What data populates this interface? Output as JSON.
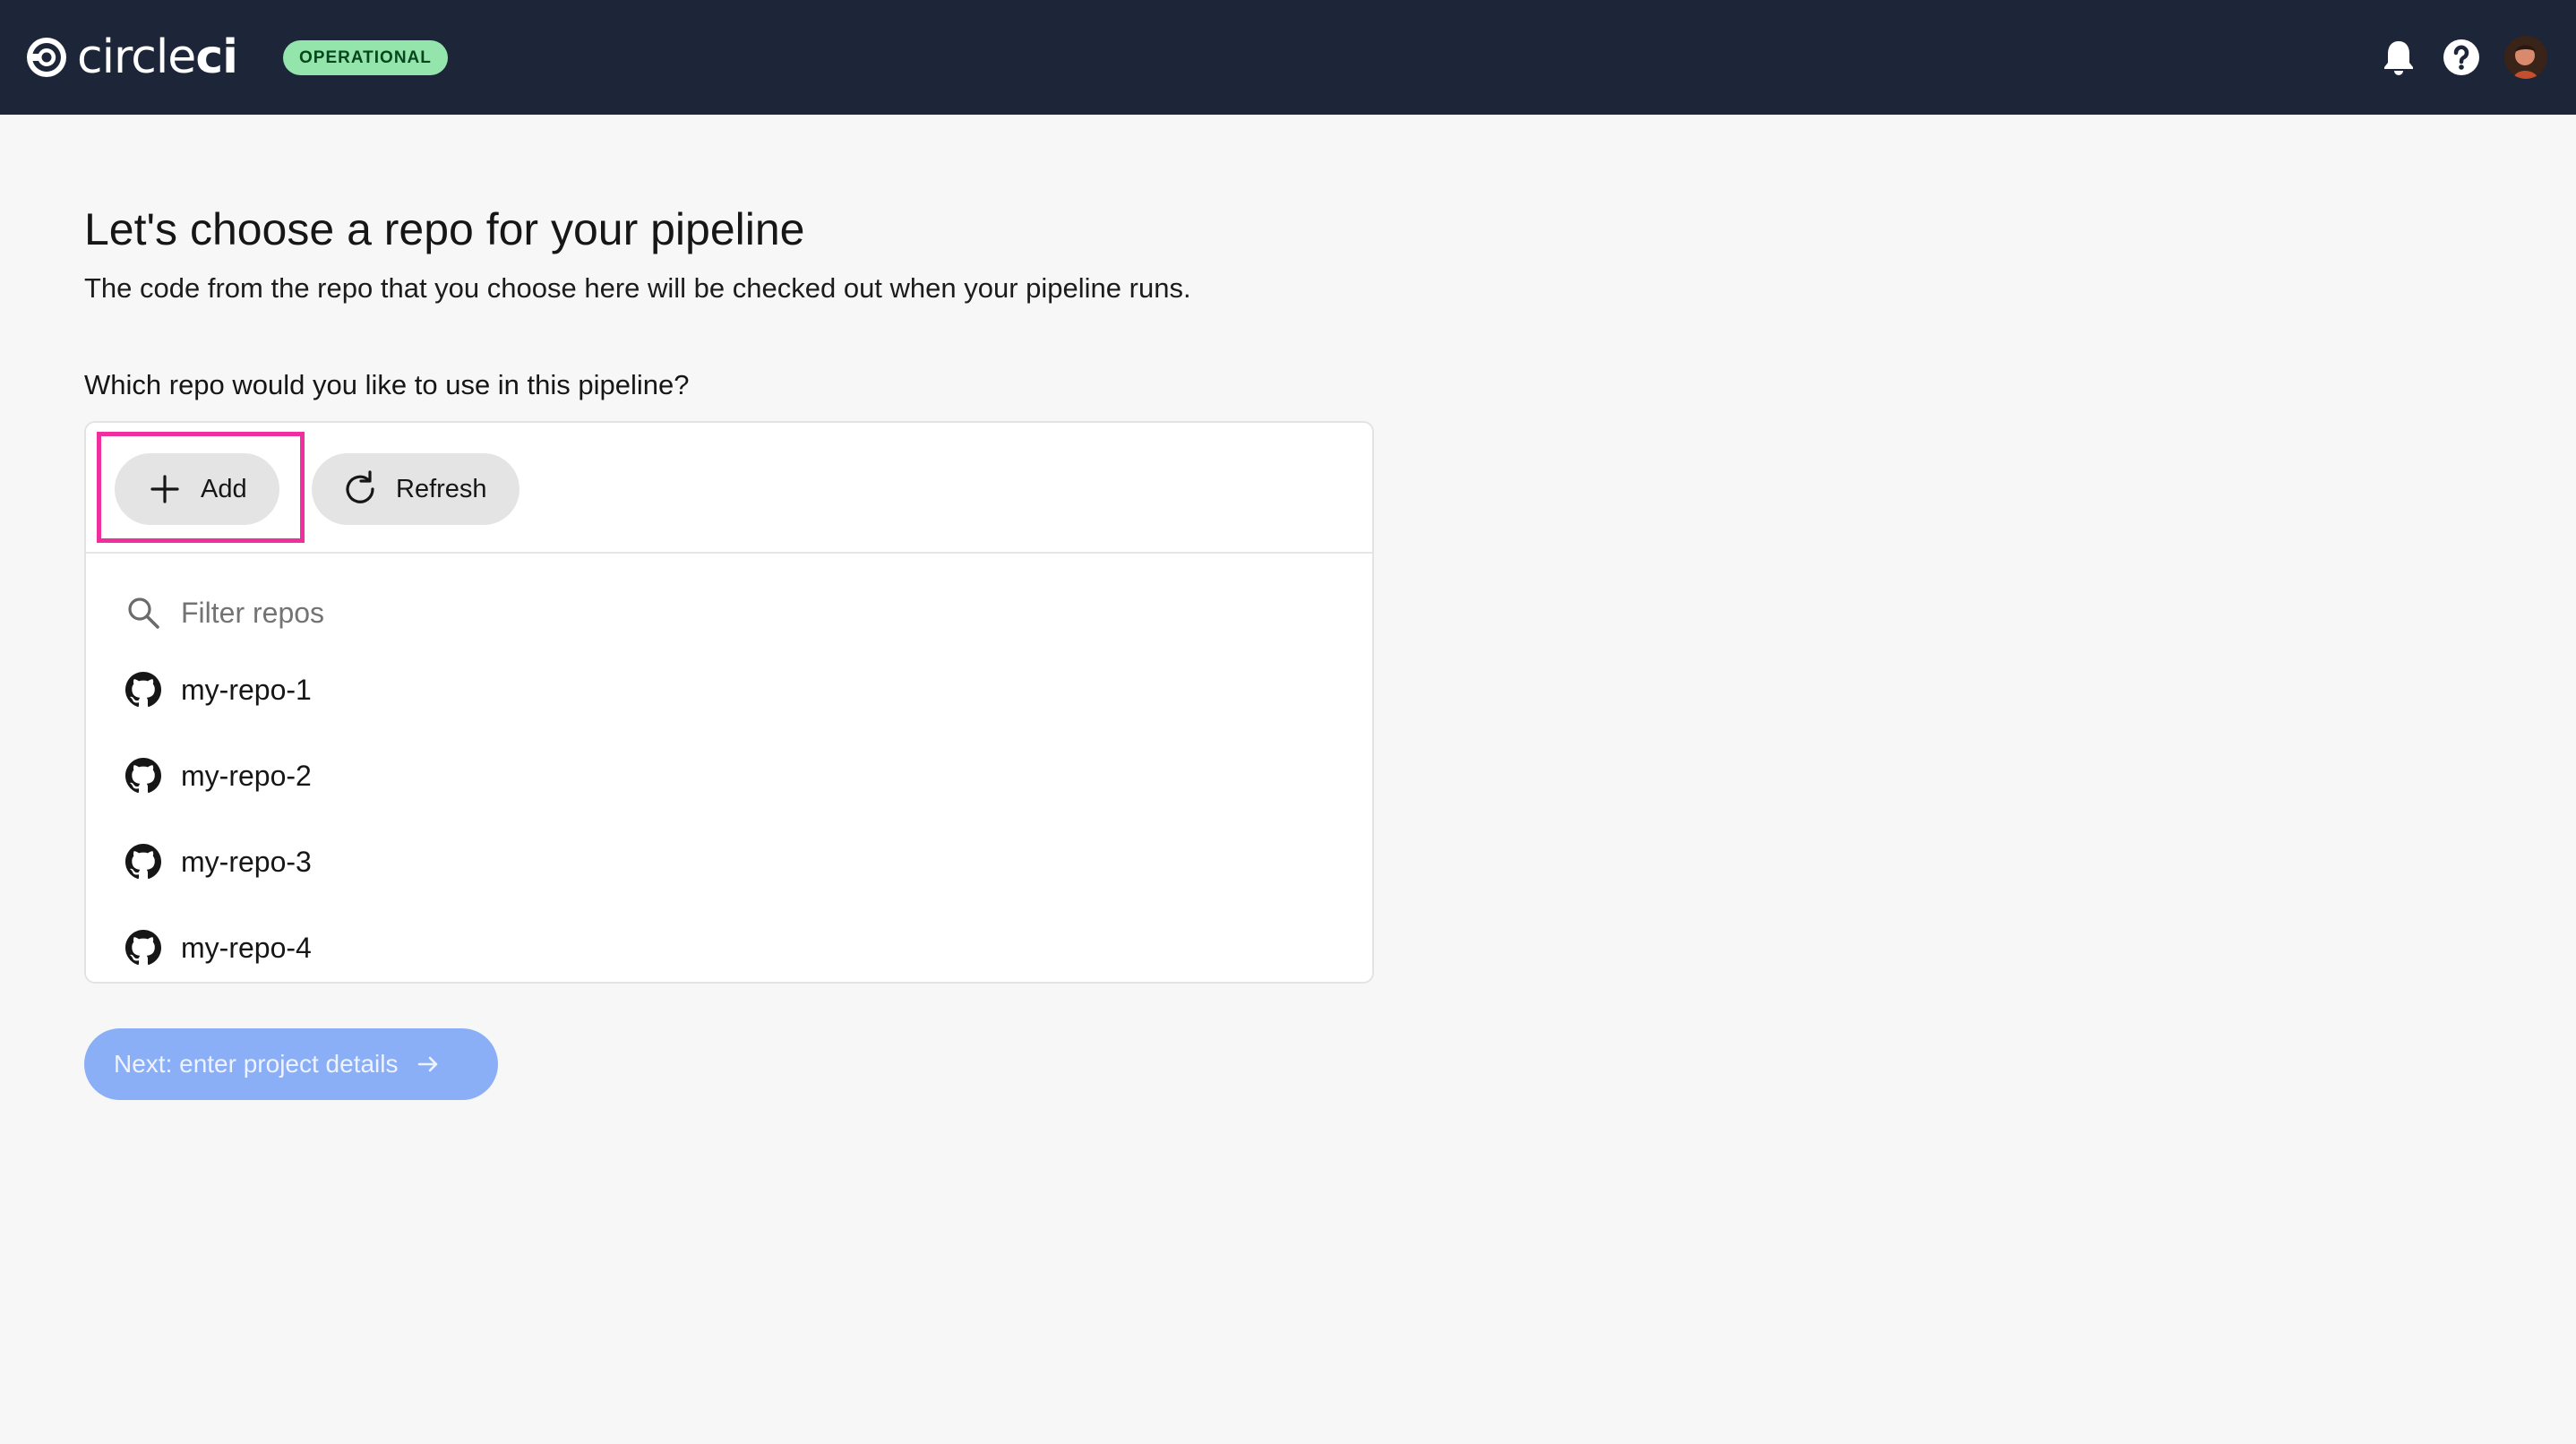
{
  "topbar": {
    "brand_light": "circle",
    "brand_bold": "ci",
    "status_badge": "OPERATIONAL",
    "icons": [
      "bell-icon",
      "help-icon",
      "user-avatar"
    ],
    "colors": {
      "background": "#1d2539",
      "badge": "#94e5ab"
    }
  },
  "main": {
    "title": "Let's choose a repo for your pipeline",
    "subtitle": "The code from the repo that you choose here will be checked out when your pipeline runs.",
    "question": "Which repo would you like to use in this pipeline?"
  },
  "toolbar": {
    "add_label": "Add",
    "refresh_label": "Refresh",
    "highlighted": "add"
  },
  "filter": {
    "placeholder": "Filter repos",
    "value": ""
  },
  "repos": [
    {
      "name": "my-repo-1",
      "icon": "github-icon"
    },
    {
      "name": "my-repo-2",
      "icon": "github-icon"
    },
    {
      "name": "my-repo-3",
      "icon": "github-icon"
    },
    {
      "name": "my-repo-4",
      "icon": "github-icon"
    }
  ],
  "footer": {
    "next_label": "Next: enter project details",
    "next_enabled": false,
    "next_color": "#8aaff7"
  },
  "colors": {
    "highlight": "#ee2f9d",
    "page_background": "#f7f7f7"
  }
}
